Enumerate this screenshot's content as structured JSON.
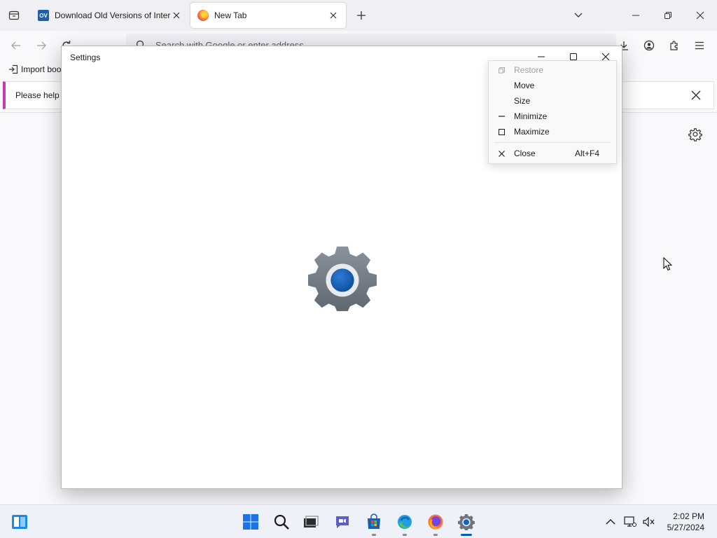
{
  "browser": {
    "tabs": [
      {
        "title": "Download Old Versions of Inter",
        "favicon_text": "OV"
      },
      {
        "title": "New Tab"
      }
    ],
    "urlbar_placeholder": "Search with Google or enter address",
    "bookmarks_toolbar": {
      "import_label": "Import boo"
    },
    "notification": {
      "text": "Please help r"
    }
  },
  "settings_window": {
    "title": "Settings"
  },
  "system_menu": {
    "items": [
      {
        "label": "Restore",
        "disabled": true
      },
      {
        "label": "Move"
      },
      {
        "label": "Size"
      },
      {
        "label": "Minimize"
      },
      {
        "label": "Maximize"
      },
      {
        "label": "Close",
        "shortcut": "Alt+F4"
      }
    ]
  },
  "taskbar": {
    "time": "2:02 PM",
    "date": "5/27/2024"
  },
  "colors": {
    "accent": "#005fb8",
    "firefox_notification": "#c53cb6"
  }
}
